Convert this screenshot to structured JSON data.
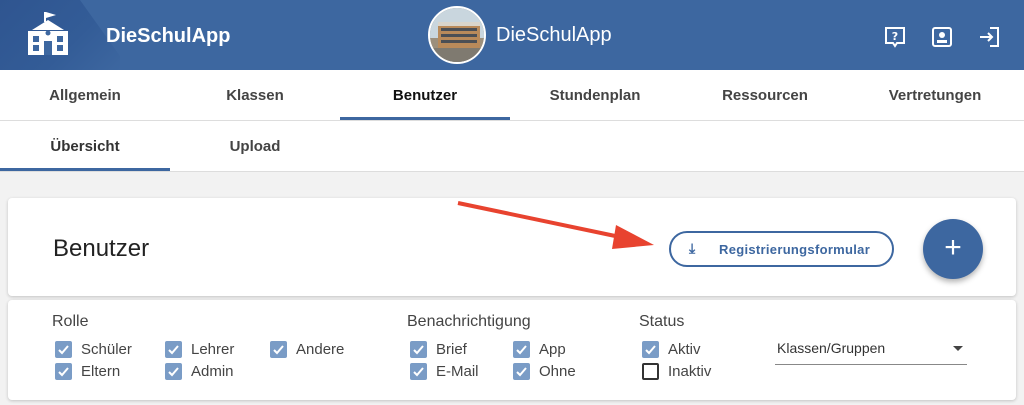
{
  "header": {
    "brand": "DieSchulApp",
    "center_title": "DieSchulApp",
    "icons": [
      "help-icon",
      "contact-card-icon",
      "logout-icon"
    ],
    "color": "#3d67a0"
  },
  "main_tabs": [
    {
      "label": "Allgemein",
      "active": false
    },
    {
      "label": "Klassen",
      "active": false
    },
    {
      "label": "Benutzer",
      "active": true
    },
    {
      "label": "Stundenplan",
      "active": false
    },
    {
      "label": "Ressourcen",
      "active": false
    },
    {
      "label": "Vertretungen",
      "active": false
    }
  ],
  "sub_tabs": [
    {
      "label": "Übersicht",
      "active": true
    },
    {
      "label": "Upload",
      "active": false
    }
  ],
  "page": {
    "title": "Benutzer",
    "register_button": "Registrierungsformular",
    "add_button": "+"
  },
  "filters": {
    "role": {
      "label": "Rolle",
      "items": [
        {
          "label": "Schüler",
          "checked": true
        },
        {
          "label": "Lehrer",
          "checked": true
        },
        {
          "label": "Andere",
          "checked": true
        },
        {
          "label": "Eltern",
          "checked": true
        },
        {
          "label": "Admin",
          "checked": true
        }
      ]
    },
    "notification": {
      "label": "Benachrichtigung",
      "items": [
        {
          "label": "Brief",
          "checked": true
        },
        {
          "label": "App",
          "checked": true
        },
        {
          "label": "E-Mail",
          "checked": true
        },
        {
          "label": "Ohne",
          "checked": true
        }
      ]
    },
    "status": {
      "label": "Status",
      "items": [
        {
          "label": "Aktiv",
          "checked": true
        },
        {
          "label": "Inaktiv",
          "checked": false
        }
      ]
    },
    "group_select": {
      "value": "Klassen/Gruppen"
    }
  },
  "annotation": {
    "arrow_color": "#e8432f"
  }
}
